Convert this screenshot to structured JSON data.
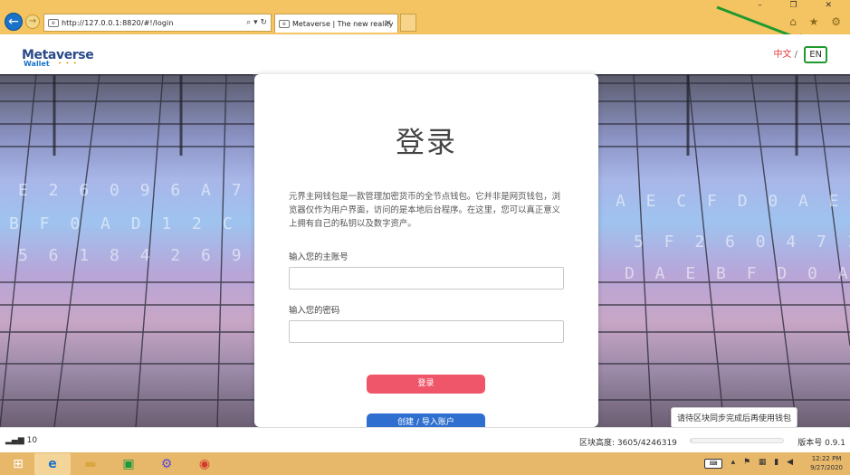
{
  "browser": {
    "address_url": "http://127.0.0.1:8820/#!/login",
    "address_icon": "page-icon",
    "address_tools": "⌕ ▾ ↻",
    "tab_title": "Metaverse | The new reality",
    "tab_close": "×",
    "window_controls": "– ❐ ✕",
    "toolbar_icons": "⌂ ★ ⚙",
    "accent_color": "#f4c462"
  },
  "header": {
    "logo_text": "Metaverse",
    "logo_sub": "Wallet",
    "lang_zh": "中文",
    "lang_sep": "/",
    "lang_en": "EN"
  },
  "login": {
    "title": "登录",
    "description": "元界主网钱包是一款管理加密货币的全节点钱包。它并非是网页钱包，浏览器仅作为用户界面，访问的是本地后台程序。在这里，您可以真正意义上拥有自己的私钥以及数字资产。",
    "account_label": "输入您的主账号",
    "account_value": "",
    "password_label": "输入您的密码",
    "password_value": "",
    "login_button": "登录",
    "create_button": "创建 / 导入账户",
    "login_button_color": "#f0566a",
    "create_button_color": "#2f6fd0"
  },
  "status": {
    "peers": "10",
    "block_height_label": "区块高度: 3605/4246319",
    "sync_progress": 0.00085,
    "version": "版本号 0.9.1",
    "tooltip": "请待区块同步完成后再使用钱包"
  },
  "taskbar": {
    "items": [
      "start-icon",
      "ie-icon",
      "explorer-icon",
      "store-icon",
      "settings-icon",
      "chrome-icon"
    ],
    "time": "12:22 PM",
    "date": "9/27/2020"
  }
}
